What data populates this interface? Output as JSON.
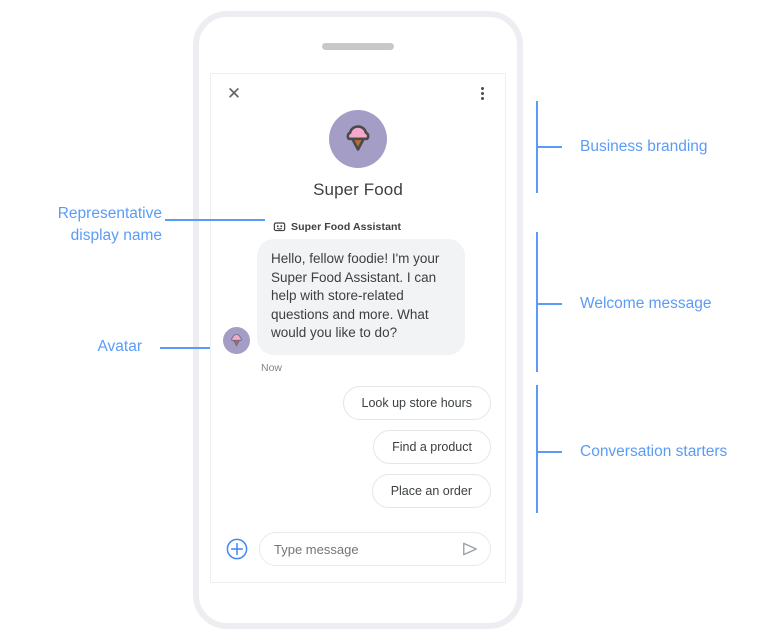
{
  "phone": {
    "speaker_name": "speaker-grille"
  },
  "chat": {
    "header": {
      "close_icon": "close-icon",
      "menu_icon": "overflow-menu-icon"
    },
    "branding": {
      "logo_icon": "ice-cream-cone-logo",
      "business_name": "Super Food",
      "logo_circle_color": "#a49ec7",
      "scoop_color": "#f5a9c8",
      "cone_color": "#b5702f",
      "outline_color": "#4a4a4a"
    },
    "representative": {
      "icon": "smart-toy-robot-icon",
      "display_name": "Super Food Assistant"
    },
    "message": {
      "avatar_icon": "ice-cream-cone-avatar",
      "text": "Hello, fellow foodie! I'm your Super Food Assistant. I can help with store-related questions and more. What would you like to do?",
      "timestamp": "Now"
    },
    "starters": [
      {
        "label": "Look up store hours"
      },
      {
        "label": "Find a product"
      },
      {
        "label": "Place an order"
      }
    ],
    "composer": {
      "plus_icon": "add-circle-icon",
      "placeholder": "Type message",
      "value": "",
      "send_icon": "send-icon",
      "accent_color": "#4285f4"
    }
  },
  "annotations": {
    "accent_color": "#5b9bf8",
    "left": [
      {
        "label": "Representative\ndisplay name",
        "target": "representative-display-name"
      },
      {
        "label": "Avatar",
        "target": "message-avatar"
      }
    ],
    "right": [
      {
        "label": "Business branding",
        "target": "branding-section"
      },
      {
        "label": "Welcome message",
        "target": "welcome-message-section"
      },
      {
        "label": "Conversation starters",
        "target": "conversation-starters-section"
      }
    ]
  }
}
